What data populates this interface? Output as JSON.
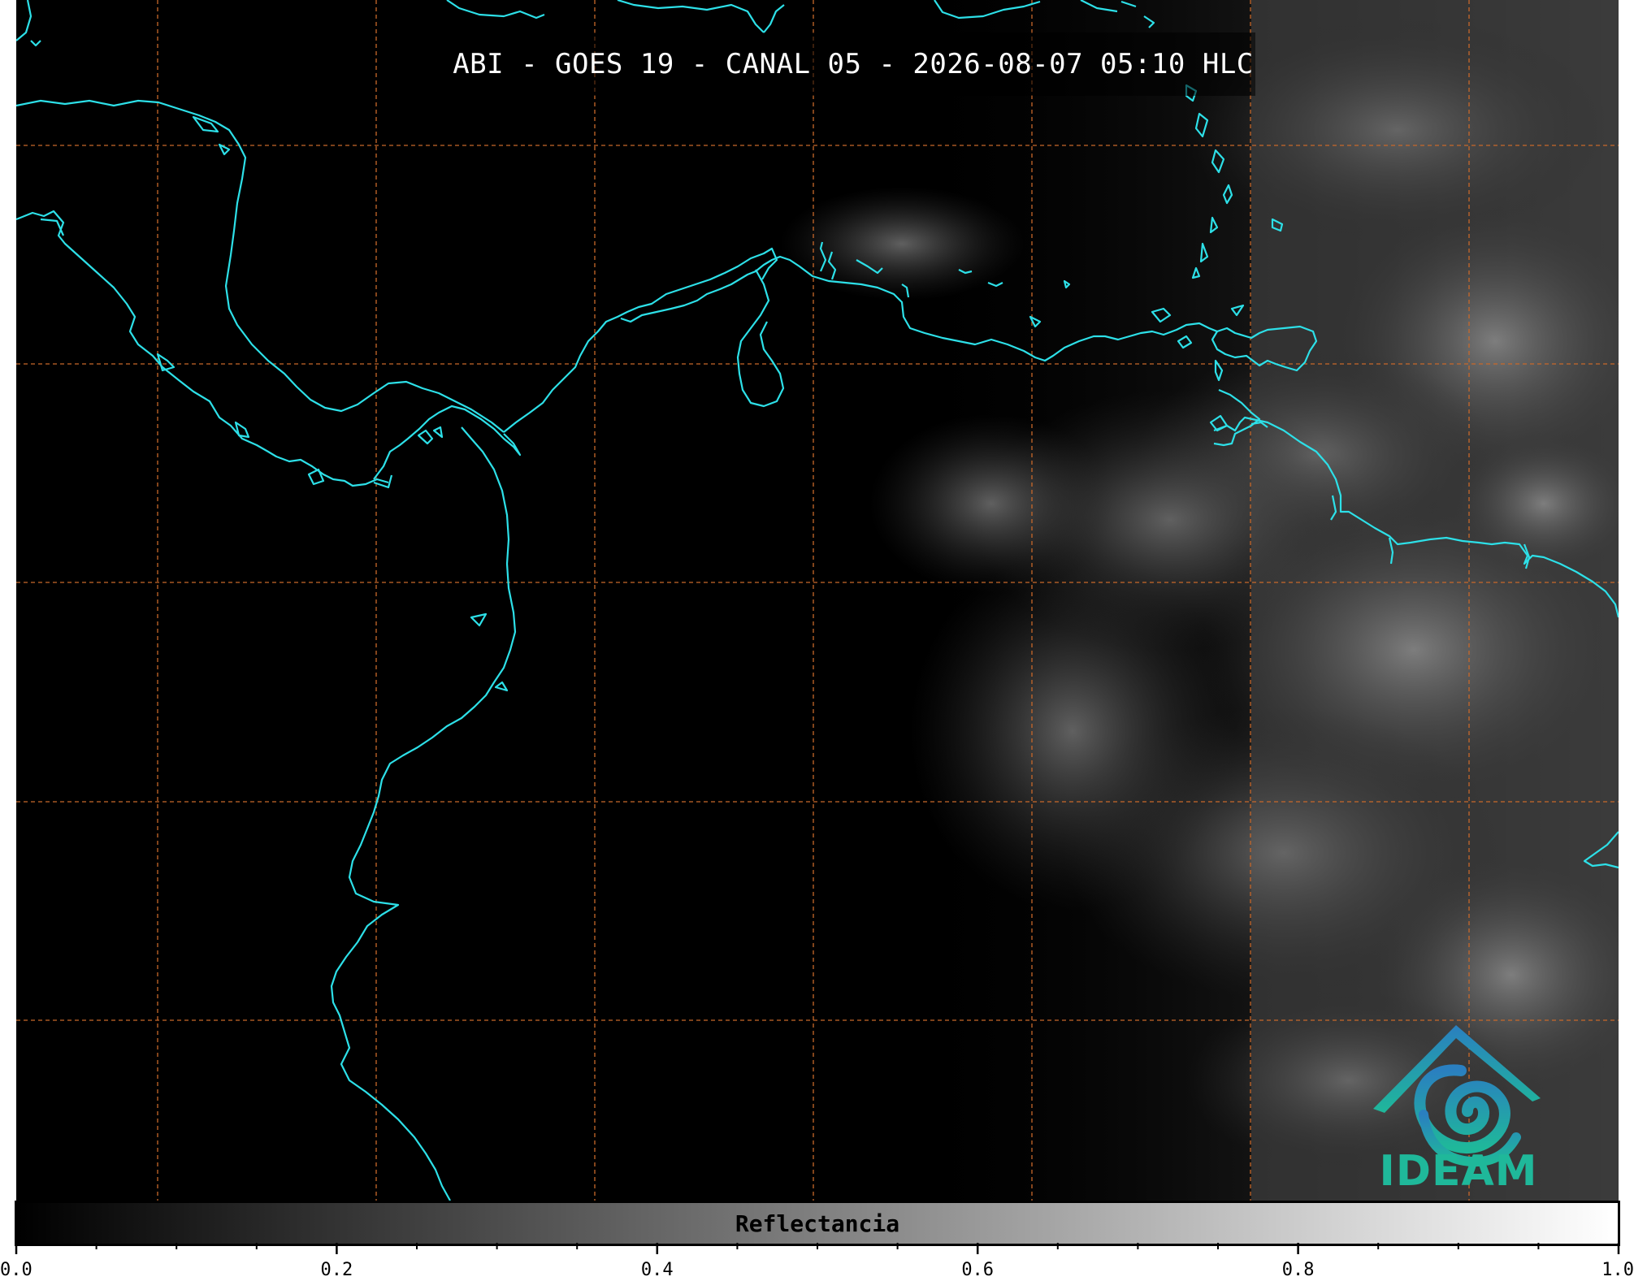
{
  "title": "ABI - GOES 19 - CANAL 05 - 2026-08-07 05:10 HLC",
  "logo": {
    "text": "IDEAM",
    "color": "#1fb89a",
    "accent": "#2a7fc0"
  },
  "colorbar": {
    "label": "Reflectancia",
    "min": 0.0,
    "max": 1.0,
    "colormap": "grayscale black-to-white",
    "major_ticks": [
      "0.0",
      "0.2",
      "0.4",
      "0.6",
      "0.8",
      "1.0"
    ],
    "major_values": [
      0.0,
      0.2,
      0.4,
      0.6,
      0.8,
      1.0
    ],
    "minor_step": 0.05
  },
  "map": {
    "background": "#000000",
    "coastline_color": "#2de0e8",
    "gridline_color": "#c8682a",
    "gridline_style": "dashed"
  }
}
